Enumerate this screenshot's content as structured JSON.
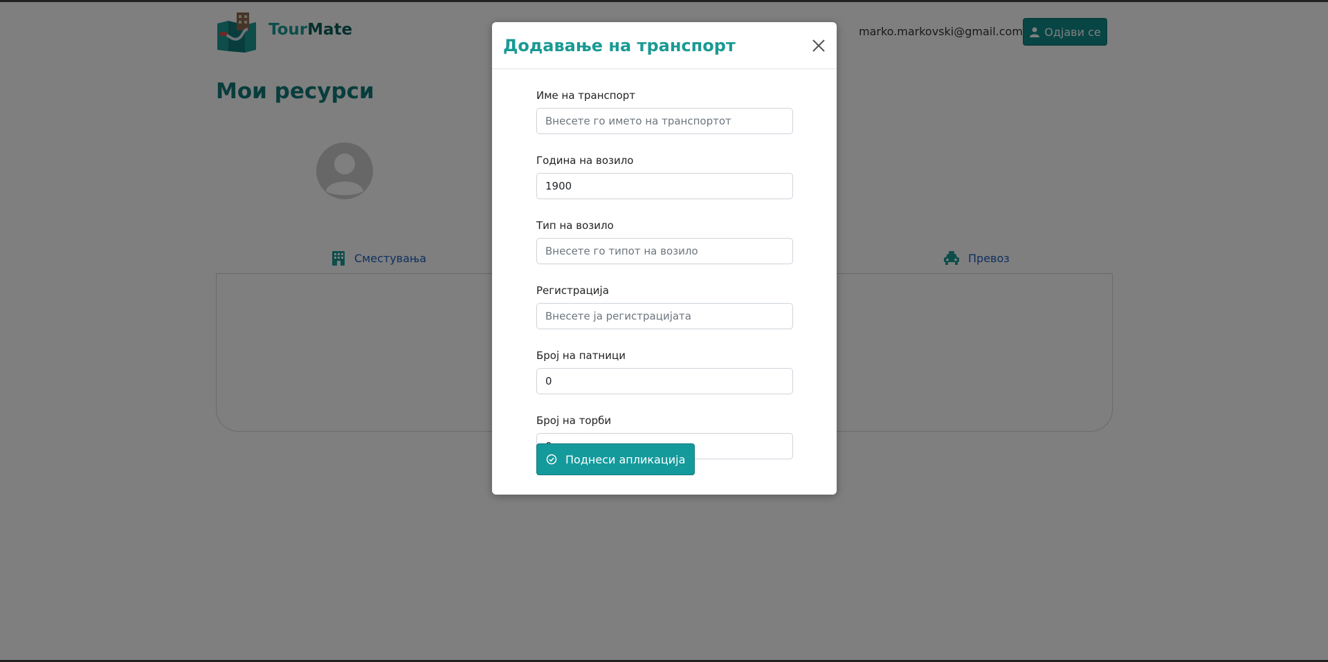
{
  "header": {
    "brand_part1": "Tour",
    "brand_part2": "Mate",
    "user_email": "marko.markovski@gmail.com",
    "logout_label": "Одјави се"
  },
  "page": {
    "title": "Мои ресурси",
    "tabs": [
      {
        "label": "Сместувања",
        "icon": "building-icon"
      },
      {
        "label": "Превоз",
        "icon": "car-icon"
      }
    ]
  },
  "modal": {
    "title": "Додавање на транспорт",
    "fields": [
      {
        "label": "Име на транспорт",
        "value": "",
        "placeholder": "Внесете го името на транспортот"
      },
      {
        "label": "Година на возило",
        "value": "1900",
        "placeholder": ""
      },
      {
        "label": "Тип на возило",
        "value": "",
        "placeholder": "Внесете го типот на возило"
      },
      {
        "label": "Регистрација",
        "value": "",
        "placeholder": "Внесете ја регистрацијата"
      },
      {
        "label": "Број на патници",
        "value": "0",
        "placeholder": ""
      },
      {
        "label": "Број на торби",
        "value": "0",
        "placeholder": ""
      }
    ],
    "submit_label": "Поднеси апликација"
  },
  "colors": {
    "accent": "#1a9a94",
    "button": "#118a8a",
    "link": "#1f5fbf"
  }
}
